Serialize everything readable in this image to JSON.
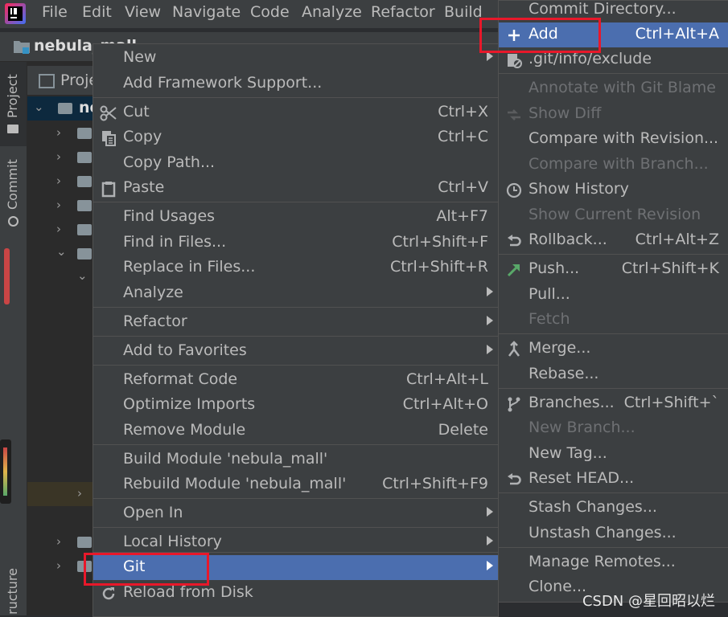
{
  "menubar": {
    "items": [
      "File",
      "Edit",
      "View",
      "Navigate",
      "Code",
      "Analyze",
      "Refactor",
      "Build"
    ]
  },
  "breadcrumb": {
    "project": "nebula_mall"
  },
  "toolstrip": {
    "project_tab": "Project",
    "commit_tab": "Commit",
    "structure_tab": "ructure"
  },
  "project_panel": {
    "header": "Proje",
    "root": "ne"
  },
  "context_menu": {
    "items": [
      {
        "label": "New",
        "shortcut": "",
        "submenu": true
      },
      {
        "label": "Add Framework Support...",
        "shortcut": ""
      },
      {
        "label": "Cut",
        "shortcut": "Ctrl+X",
        "icon": "scissors-icon"
      },
      {
        "label": "Copy",
        "shortcut": "Ctrl+C",
        "icon": "copy-icon"
      },
      {
        "label": "Copy Path...",
        "shortcut": ""
      },
      {
        "label": "Paste",
        "shortcut": "Ctrl+V",
        "icon": "clipboard-icon"
      },
      {
        "label": "Find Usages",
        "shortcut": "Alt+F7"
      },
      {
        "label": "Find in Files...",
        "shortcut": "Ctrl+Shift+F"
      },
      {
        "label": "Replace in Files...",
        "shortcut": "Ctrl+Shift+R"
      },
      {
        "label": "Analyze",
        "shortcut": "",
        "submenu": true
      },
      {
        "label": "Refactor",
        "shortcut": "",
        "submenu": true
      },
      {
        "label": "Add to Favorites",
        "shortcut": "",
        "submenu": true
      },
      {
        "label": "Reformat Code",
        "shortcut": "Ctrl+Alt+L"
      },
      {
        "label": "Optimize Imports",
        "shortcut": "Ctrl+Alt+O"
      },
      {
        "label": "Remove Module",
        "shortcut": "Delete"
      },
      {
        "label": "Build Module 'nebula_mall'",
        "shortcut": ""
      },
      {
        "label": "Rebuild Module 'nebula_mall'",
        "shortcut": "Ctrl+Shift+F9"
      },
      {
        "label": "Open In",
        "shortcut": "",
        "submenu": true
      },
      {
        "label": "Local History",
        "shortcut": "",
        "submenu": true
      },
      {
        "label": "Git",
        "shortcut": "",
        "submenu": true,
        "highlighted": true
      },
      {
        "label": "Reload from Disk",
        "shortcut": "",
        "icon": "reload-icon"
      }
    ]
  },
  "git_submenu": {
    "items": [
      {
        "label": "Commit Directory...",
        "shortcut": ""
      },
      {
        "label": "Add",
        "shortcut": "Ctrl+Alt+A",
        "icon": "plus-icon",
        "highlighted": true
      },
      {
        "label": ".git/info/exclude",
        "shortcut": "",
        "icon": "ignore-file-icon"
      },
      {
        "label": "Annotate with Git Blame",
        "shortcut": "",
        "disabled": true
      },
      {
        "label": "Show Diff",
        "shortcut": "",
        "disabled": true,
        "icon": "diff-icon"
      },
      {
        "label": "Compare with Revision...",
        "shortcut": ""
      },
      {
        "label": "Compare with Branch...",
        "shortcut": "",
        "disabled": true
      },
      {
        "label": "Show History",
        "shortcut": "",
        "icon": "clock-icon"
      },
      {
        "label": "Show Current Revision",
        "shortcut": "",
        "disabled": true
      },
      {
        "label": "Rollback...",
        "shortcut": "Ctrl+Alt+Z",
        "icon": "undo-icon"
      },
      {
        "label": "Push...",
        "shortcut": "Ctrl+Shift+K",
        "icon": "push-arrow-icon"
      },
      {
        "label": "Pull...",
        "shortcut": ""
      },
      {
        "label": "Fetch",
        "shortcut": "",
        "disabled": true
      },
      {
        "label": "Merge...",
        "shortcut": "",
        "icon": "merge-icon"
      },
      {
        "label": "Rebase...",
        "shortcut": ""
      },
      {
        "label": "Branches...",
        "shortcut": "Ctrl+Shift+`",
        "icon": "branch-icon"
      },
      {
        "label": "New Branch...",
        "shortcut": "",
        "disabled": true
      },
      {
        "label": "New Tag...",
        "shortcut": ""
      },
      {
        "label": "Reset HEAD...",
        "shortcut": "",
        "icon": "undo-icon"
      },
      {
        "label": "Stash Changes...",
        "shortcut": ""
      },
      {
        "label": "Unstash Changes...",
        "shortcut": ""
      },
      {
        "label": "Manage Remotes...",
        "shortcut": ""
      },
      {
        "label": "Clone...",
        "shortcut": ""
      }
    ]
  },
  "watermark": "CSDN @星回昭以烂",
  "colors": {
    "menu_bg": "#3c3f41",
    "highlight": "#4b6eaf",
    "annotation_red": "#e8182a",
    "push_green": "#59a869"
  }
}
